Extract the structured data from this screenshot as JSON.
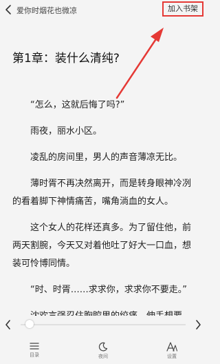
{
  "header": {
    "book_title": "爱你时烟花也微凉",
    "add_to_shelf_label": "加入书架"
  },
  "chapter": {
    "title": "第1章：装什么清纯?"
  },
  "paragraphs": [
    "“怎么，这就后悔了吗?”",
    "雨夜，丽水小区。",
    "凌乱的房间里，男人的声音薄凉无比。",
    "薄时胥不再决然离开，而是转身眼神冷冽的看着脚下神情痛苦，嘴角淌血的女人。",
    "这个女人的花样还真多。为了留住他，前两天割腕，今天又对着他吐了好大一口血，想装可怜博同情。",
    "“时、时胥……求求你，求求你不要走。”",
    "沈欢言强忍住胸腔里的绞痛，伸手想要"
  ],
  "toolbar": {
    "catalog_label": "目录",
    "night_label": "夜间",
    "settings_label": "设置"
  },
  "reading_progress": 0.03,
  "colors": {
    "highlight": "#e53935",
    "background": "#f4f4f4"
  }
}
